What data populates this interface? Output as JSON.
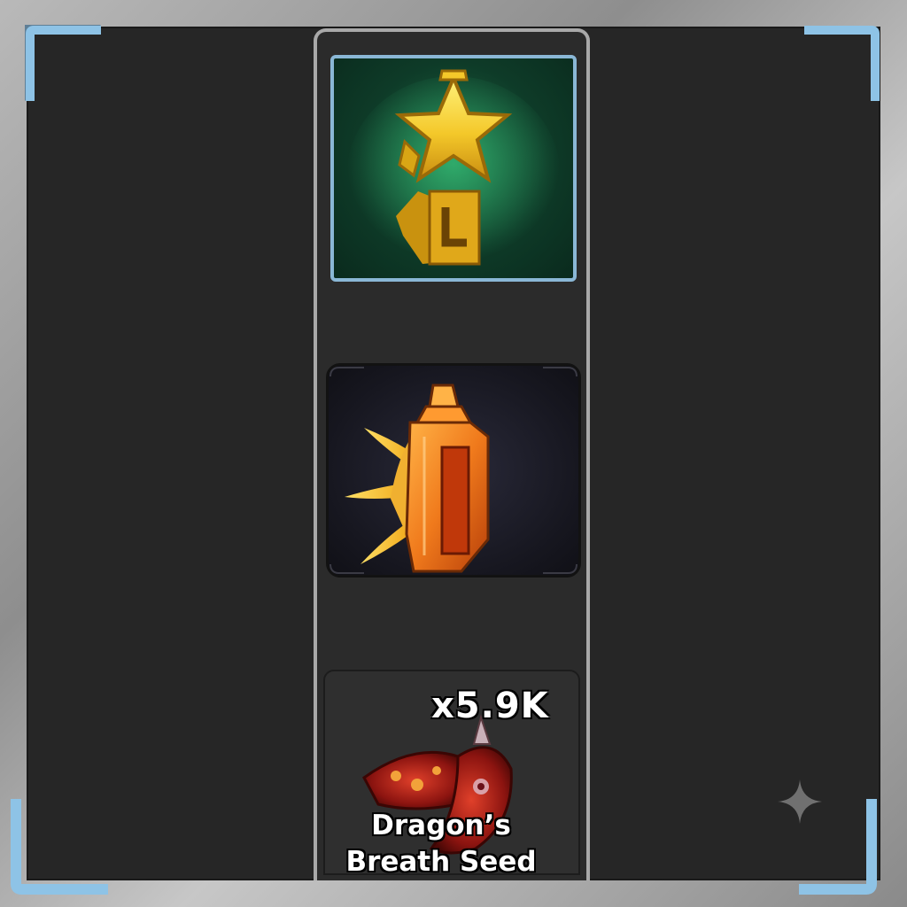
{
  "inventory": {
    "slots": [
      {
        "item_icon": "golden-star-trophy-icon",
        "frame_color": "#8ab7d6"
      },
      {
        "item_icon": "orange-crystal-claw-icon"
      },
      {
        "item_icon": "dragon-breath-seed-icon",
        "quantity": "x5.9K",
        "name_line1": "Dragon’s",
        "name_line2": "Breath Seed"
      }
    ]
  },
  "colors": {
    "panel_background": "#262626",
    "frame_metal": "#a9a9a9",
    "corner_accent": "#8ec3e6",
    "highlight_frame": "#8ab7d6"
  },
  "decor": {
    "sparkle_icon": "sparkle-icon"
  }
}
